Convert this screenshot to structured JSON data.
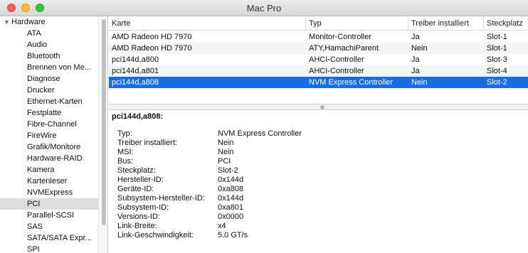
{
  "window": {
    "title": "Mac Pro"
  },
  "sidebar": {
    "group": "Hardware",
    "items": [
      "ATA",
      "Audio",
      "Bluetooth",
      "Brennen von Me...",
      "Diagnose",
      "Drucker",
      "Ethernet-Karten",
      "Festplatte",
      "Fibre-Channel",
      "FireWire",
      "Grafik/Monitore",
      "Hardware-RAID",
      "Kamera",
      "Kartenleser",
      "NVMExpress",
      "PCI",
      "Parallel-SCSI",
      "SAS",
      "SATA/SATA Expr...",
      "SPI"
    ],
    "selected": "PCI"
  },
  "table": {
    "columns": [
      "Karte",
      "Typ",
      "Treiber installiert",
      "Steckplatz"
    ],
    "rows": [
      [
        "AMD Radeon HD 7970",
        "Monitor-Controller",
        "Ja",
        "Slot-1"
      ],
      [
        "AMD Radeon HD 7970",
        "ATY,HamachiParent",
        "Nein",
        "Slot-1"
      ],
      [
        "pci144d,a800",
        "AHCI-Controller",
        "Ja",
        "Slot-3"
      ],
      [
        "pci144d,a801",
        "AHCI-Controller",
        "Ja",
        "Slot-4"
      ],
      [
        "pci144d,a808",
        "NVM Express Controller",
        "Nein",
        "Slot-2"
      ]
    ],
    "selected_row": "pci144d,a808"
  },
  "detail": {
    "title": "pci144d,a808:",
    "fields": [
      [
        "Typ:",
        "NVM Express Controller"
      ],
      [
        "Treiber installiert:",
        "Nein"
      ],
      [
        "MSI:",
        "Nein"
      ],
      [
        "Bus:",
        "PCI"
      ],
      [
        "Steckplatz:",
        "Slot-2"
      ],
      [
        "Hersteller-ID:",
        "0x144d"
      ],
      [
        "Geräte-ID:",
        "0xa808"
      ],
      [
        "Subsystem-Hersteller-ID:",
        "0x144d"
      ],
      [
        "Subsystem-ID:",
        "0xa801"
      ],
      [
        "Versions-ID:",
        "0x0000"
      ],
      [
        "Link-Breite:",
        "x4"
      ],
      [
        "Link-Geschwindigkeit:",
        "5.0 GT/s"
      ]
    ]
  }
}
